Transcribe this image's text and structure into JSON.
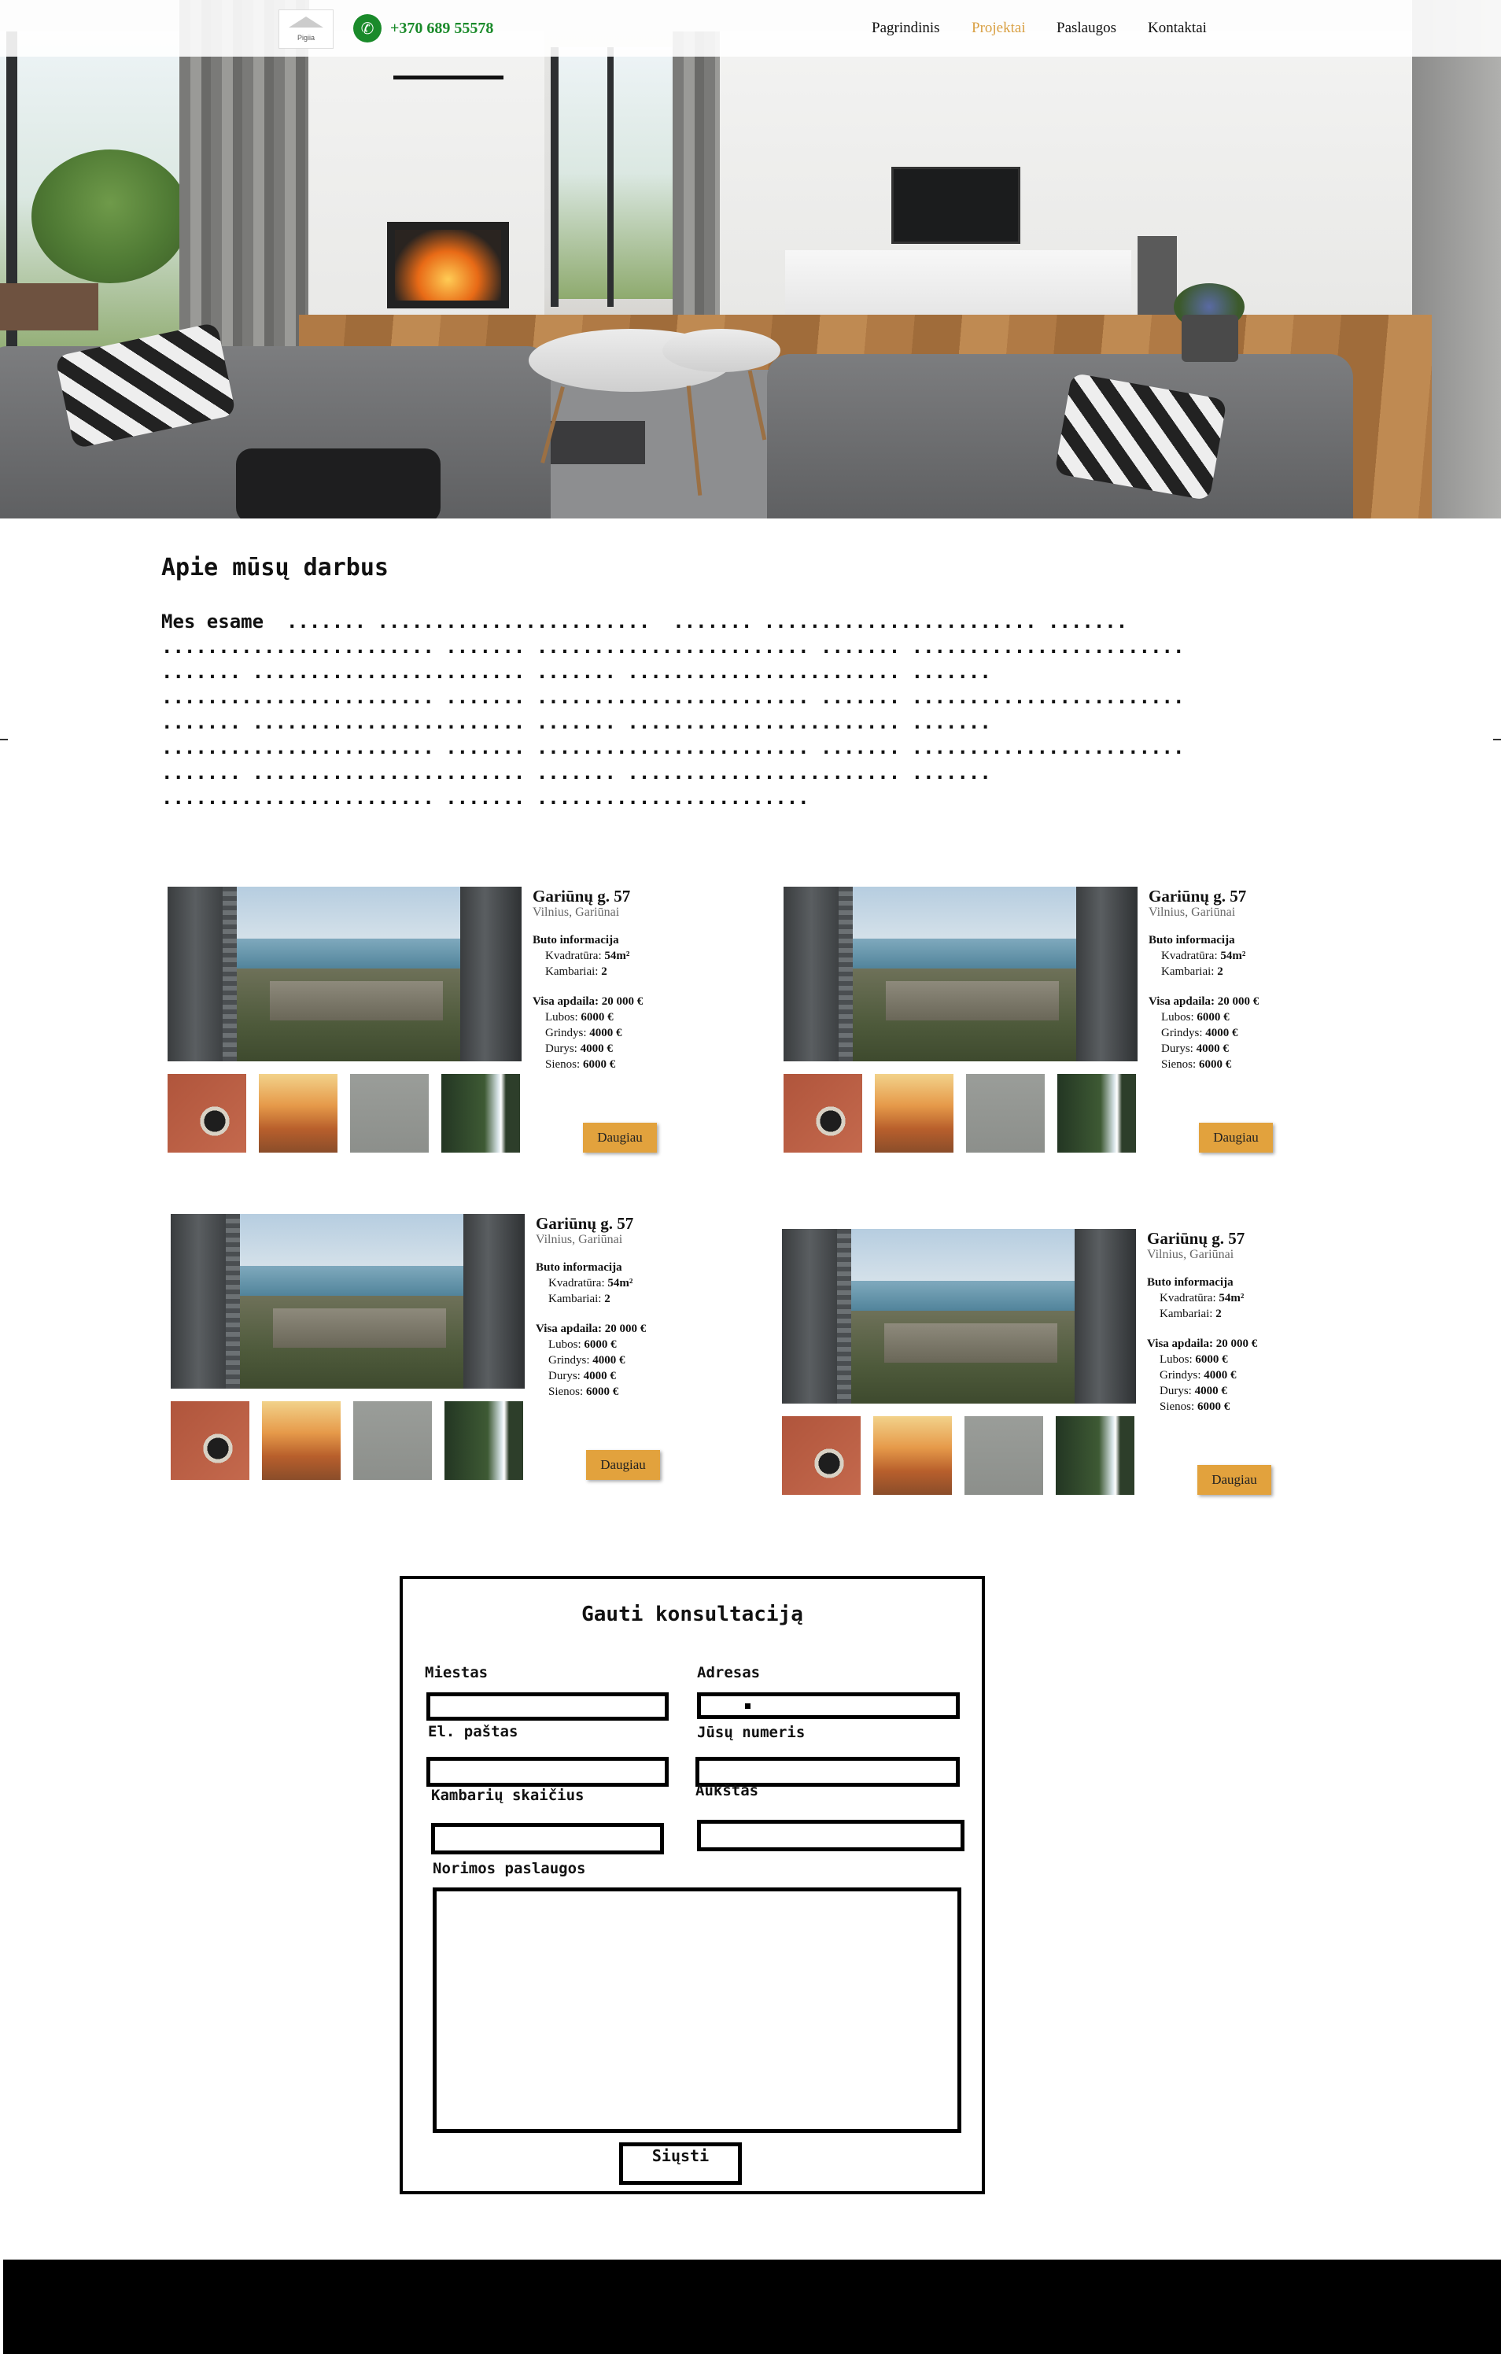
{
  "nav": {
    "phone": "+370 689 55578",
    "logo_text": "Pigiia",
    "links": [
      "Pagrindinis",
      "Projektai",
      "Paslaugos",
      "Kontaktai"
    ],
    "active_link": "Projektai"
  },
  "colors": {
    "accent": "#d9a043",
    "button": "#e2a23d",
    "phone_green": "#1a8a2a",
    "footer": "#000000"
  },
  "icons": [
    "phone-icon"
  ],
  "about": {
    "title": "Apie mūsų darbus",
    "text": "Mes esame  ....... ........................  ....... ........................ .......\n........................ ....... ........................ ....... ........................\n....... ........................ ....... ........................ .......\n........................ ....... ........................ ....... ........................\n....... ........................ ....... ........................ .......\n........................ ....... ........................ ....... ........................\n....... ........................ ....... ........................ .......\n........................ ....... ........................"
  },
  "projects": [
    {
      "title": "Gariūnų g. 57",
      "city": "Vilnius, Gariūnai",
      "info_heading": "Buto informacija",
      "area_label": "Kvadratūra:",
      "area_value": "54m²",
      "rooms_label": "Kambariai:",
      "rooms_value": "2",
      "finish_label": "Visa apdaila:",
      "finish_value": "20 000 €",
      "items": [
        {
          "label": "Lubos:",
          "value": "6000 €"
        },
        {
          "label": "Grindys:",
          "value": "4000 €"
        },
        {
          "label": "Durys:",
          "value": "4000 €"
        },
        {
          "label": "Sienos:",
          "value": "6000 €"
        }
      ],
      "button": "Daugiau"
    },
    {
      "title": "Gariūnų g. 57",
      "city": "Vilnius, Gariūnai",
      "info_heading": "Buto informacija",
      "area_label": "Kvadratūra:",
      "area_value": "54m²",
      "rooms_label": "Kambariai:",
      "rooms_value": "2",
      "finish_label": "Visa apdaila:",
      "finish_value": "20 000 €",
      "items": [
        {
          "label": "Lubos:",
          "value": "6000 €"
        },
        {
          "label": "Grindys:",
          "value": "4000 €"
        },
        {
          "label": "Durys:",
          "value": "4000 €"
        },
        {
          "label": "Sienos:",
          "value": "6000 €"
        }
      ],
      "button": "Daugiau"
    },
    {
      "title": "Gariūnų g. 57",
      "city": "Vilnius, Gariūnai",
      "info_heading": "Buto informacija",
      "area_label": "Kvadratūra:",
      "area_value": "54m²",
      "rooms_label": "Kambariai:",
      "rooms_value": "2",
      "finish_label": "Visa apdaila:",
      "finish_value": "20 000 €",
      "items": [
        {
          "label": "Lubos:",
          "value": "6000 €"
        },
        {
          "label": "Grindys:",
          "value": "4000 €"
        },
        {
          "label": "Durys:",
          "value": "4000 €"
        },
        {
          "label": "Sienos:",
          "value": "6000 €"
        }
      ],
      "button": "Daugiau"
    },
    {
      "title": "Gariūnų g. 57",
      "city": "Vilnius, Gariūnai",
      "info_heading": "Buto informacija",
      "area_label": "Kvadratūra:",
      "area_value": "54m²",
      "rooms_label": "Kambariai:",
      "rooms_value": "2",
      "finish_label": "Visa apdaila:",
      "finish_value": "20 000 €",
      "items": [
        {
          "label": "Lubos:",
          "value": "6000 €"
        },
        {
          "label": "Grindys:",
          "value": "4000 €"
        },
        {
          "label": "Durys:",
          "value": "4000 €"
        },
        {
          "label": "Sienos:",
          "value": "6000 €"
        }
      ],
      "button": "Daugiau"
    }
  ],
  "form": {
    "title": "Gauti konsultaciją",
    "city_label": "Miestas",
    "address_label": "Adresas",
    "email_label": "El. paštas",
    "phone_label": "Jūsų numeris",
    "rooms_label": "Kambarių skaičius",
    "floor_label": "Aukštas",
    "services_label": "Norimos paslaugos",
    "submit": "Siųsti"
  }
}
